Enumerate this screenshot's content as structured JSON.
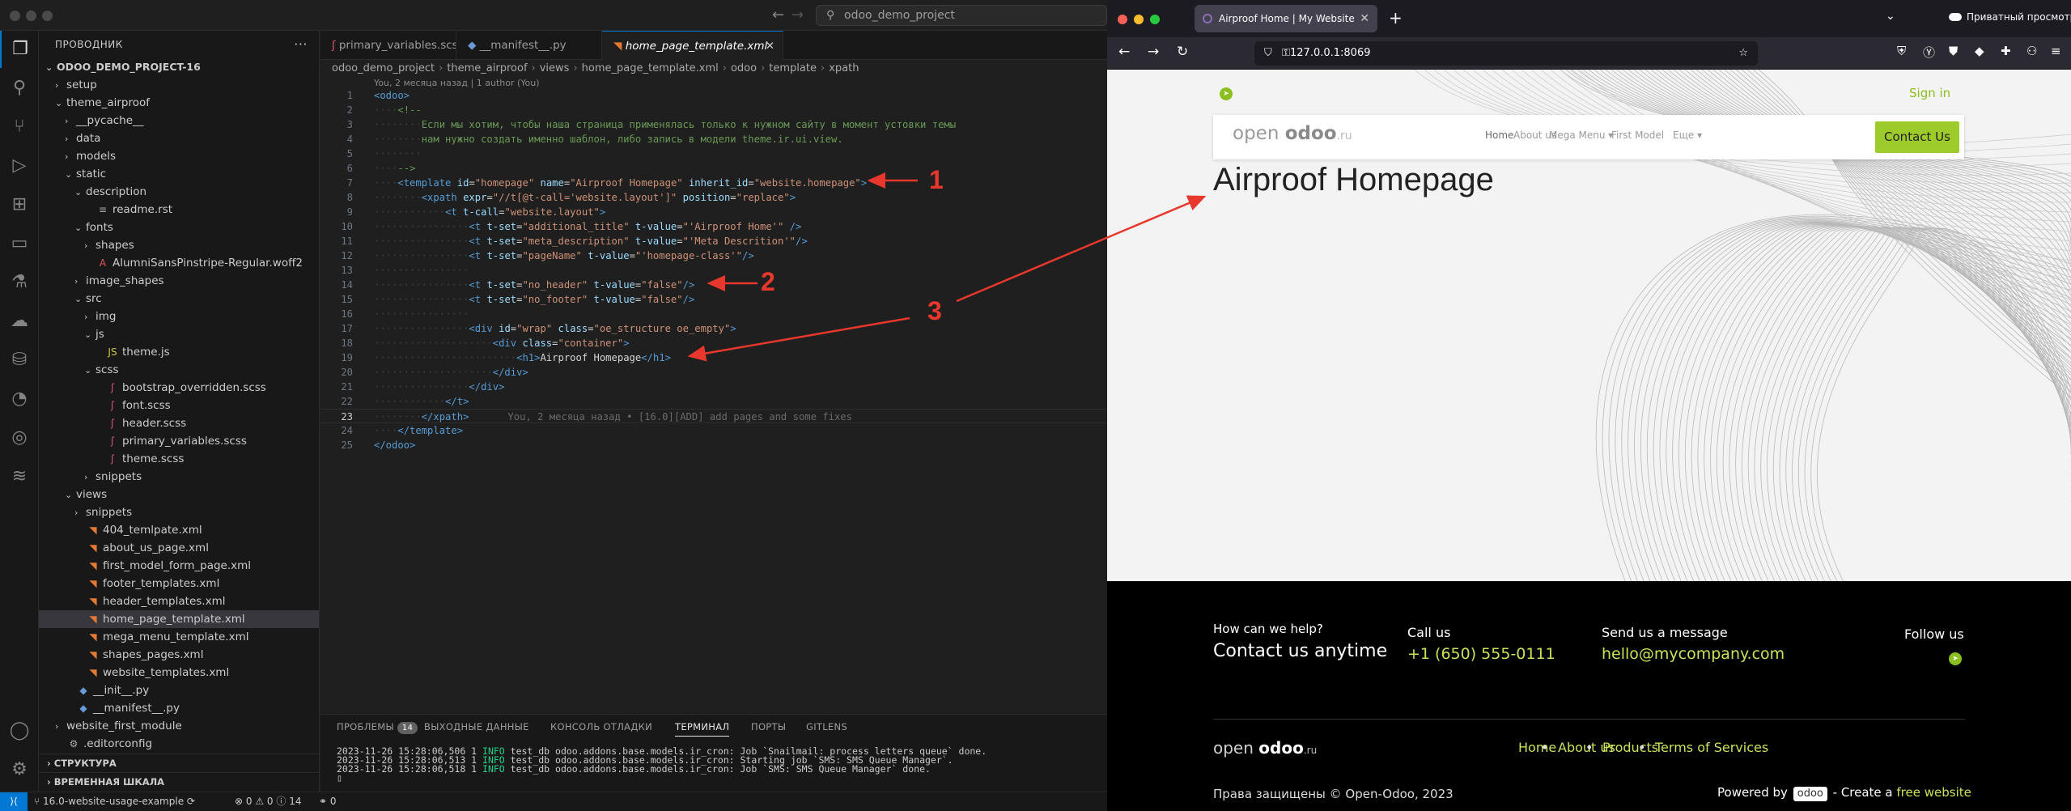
{
  "vscode": {
    "search_text": "odoo_demo_project",
    "sidebar_title": "ПРОВОДНИК",
    "tree": [
      {
        "label": "ODOO_DEMO_PROJECT-16",
        "depth": 0,
        "arrow": "down",
        "icon": "",
        "bold": true
      },
      {
        "label": "setup",
        "depth": 1,
        "arrow": "right",
        "icon": "",
        "bold": false
      },
      {
        "label": "theme_airproof",
        "depth": 1,
        "arrow": "down",
        "icon": "",
        "bold": false
      },
      {
        "label": "__pycache__",
        "depth": 2,
        "arrow": "right",
        "icon": "",
        "bold": false
      },
      {
        "label": "data",
        "depth": 2,
        "arrow": "right",
        "icon": "",
        "bold": false
      },
      {
        "label": "models",
        "depth": 2,
        "arrow": "right",
        "icon": "",
        "bold": false
      },
      {
        "label": "static",
        "depth": 2,
        "arrow": "down",
        "icon": "",
        "bold": false
      },
      {
        "label": "description",
        "depth": 3,
        "arrow": "down",
        "icon": "",
        "bold": false
      },
      {
        "label": "readme.rst",
        "depth": 4,
        "arrow": "",
        "icon": "rst",
        "bold": false
      },
      {
        "label": "fonts",
        "depth": 3,
        "arrow": "down",
        "icon": "",
        "bold": false
      },
      {
        "label": "shapes",
        "depth": 4,
        "arrow": "right",
        "icon": "",
        "bold": false
      },
      {
        "label": "AlumniSansPinstripe-Regular.woff2",
        "depth": 4,
        "arrow": "",
        "icon": "font",
        "bold": false
      },
      {
        "label": "image_shapes",
        "depth": 3,
        "arrow": "right",
        "icon": "",
        "bold": false
      },
      {
        "label": "src",
        "depth": 3,
        "arrow": "down",
        "icon": "",
        "bold": false
      },
      {
        "label": "img",
        "depth": 4,
        "arrow": "right",
        "icon": "",
        "bold": false
      },
      {
        "label": "js",
        "depth": 4,
        "arrow": "down",
        "icon": "",
        "bold": false
      },
      {
        "label": "theme.js",
        "depth": 5,
        "arrow": "",
        "icon": "js",
        "bold": false
      },
      {
        "label": "scss",
        "depth": 4,
        "arrow": "down",
        "icon": "",
        "bold": false
      },
      {
        "label": "bootstrap_overridden.scss",
        "depth": 5,
        "arrow": "",
        "icon": "scss",
        "bold": false
      },
      {
        "label": "font.scss",
        "depth": 5,
        "arrow": "",
        "icon": "scss",
        "bold": false
      },
      {
        "label": "header.scss",
        "depth": 5,
        "arrow": "",
        "icon": "scss",
        "bold": false
      },
      {
        "label": "primary_variables.scss",
        "depth": 5,
        "arrow": "",
        "icon": "scss",
        "bold": false
      },
      {
        "label": "theme.scss",
        "depth": 5,
        "arrow": "",
        "icon": "scss",
        "bold": false
      },
      {
        "label": "snippets",
        "depth": 4,
        "arrow": "right",
        "icon": "",
        "bold": false
      },
      {
        "label": "views",
        "depth": 2,
        "arrow": "down",
        "icon": "",
        "bold": false
      },
      {
        "label": "snippets",
        "depth": 3,
        "arrow": "right",
        "icon": "",
        "bold": false
      },
      {
        "label": "404_temlpate.xml",
        "depth": 3,
        "arrow": "",
        "icon": "xml",
        "bold": false
      },
      {
        "label": "about_us_page.xml",
        "depth": 3,
        "arrow": "",
        "icon": "xml",
        "bold": false
      },
      {
        "label": "first_model_form_page.xml",
        "depth": 3,
        "arrow": "",
        "icon": "xml",
        "bold": false
      },
      {
        "label": "footer_templates.xml",
        "depth": 3,
        "arrow": "",
        "icon": "xml",
        "bold": false
      },
      {
        "label": "header_templates.xml",
        "depth": 3,
        "arrow": "",
        "icon": "xml",
        "bold": false
      },
      {
        "label": "home_page_template.xml",
        "depth": 3,
        "arrow": "",
        "icon": "xml",
        "bold": false,
        "selected": true
      },
      {
        "label": "mega_menu_template.xml",
        "depth": 3,
        "arrow": "",
        "icon": "xml",
        "bold": false
      },
      {
        "label": "shapes_pages.xml",
        "depth": 3,
        "arrow": "",
        "icon": "xml",
        "bold": false
      },
      {
        "label": "website_templates.xml",
        "depth": 3,
        "arrow": "",
        "icon": "xml",
        "bold": false
      },
      {
        "label": "__init__.py",
        "depth": 2,
        "arrow": "",
        "icon": "py",
        "bold": false
      },
      {
        "label": "__manifest__.py",
        "depth": 2,
        "arrow": "",
        "icon": "py",
        "bold": false
      },
      {
        "label": "website_first_module",
        "depth": 1,
        "arrow": "right",
        "icon": "",
        "bold": false
      },
      {
        "label": ".editorconfig",
        "depth": 1,
        "arrow": "",
        "icon": "cfg",
        "bold": false
      }
    ],
    "outline_label": "СТРУКТУРА",
    "timeline_label": "ВРЕМЕННАЯ ШКАЛА",
    "tabs": [
      {
        "label": "primary_variables.scss",
        "icon": "scss",
        "active": false
      },
      {
        "label": "__manifest__.py",
        "icon": "py",
        "active": false
      },
      {
        "label": "home_page_template.xml",
        "icon": "xml",
        "active": true
      }
    ],
    "breadcrumb": [
      "odoo_demo_project",
      "theme_airproof",
      "views",
      "home_page_template.xml",
      "odoo",
      "template",
      "xpath"
    ],
    "blame_top": "You, 2 месяца назад | 1 author (You)",
    "ghost_blame": "You, 2 месяца назад • [16.0][ADD] add pages and some fixes",
    "current_line": 23,
    "panel_tabs": [
      "ПРОБЛЕМЫ",
      "ВЫХОДНЫЕ ДАННЫЕ",
      "КОНСОЛЬ ОТЛАДКИ",
      "ТЕРМИНАЛ",
      "ПОРТЫ",
      "GITLENS"
    ],
    "problems_count": "14",
    "active_panel_tab": "ТЕРМИНАЛ",
    "terminal": [
      {
        "prefix": "2023-11-26 15:28:06,506 1 ",
        "level": "INFO",
        "rest": " test_db odoo.addons.base.models.ir_cron: Job `Snailmail: process letters queue` done."
      },
      {
        "prefix": "2023-11-26 15:28:06,513 1 ",
        "level": "INFO",
        "rest": " test_db odoo.addons.base.models.ir_cron: Starting job `SMS: SMS Queue Manager`."
      },
      {
        "prefix": "2023-11-26 15:28:06,518 1 ",
        "level": "INFO",
        "rest": " test_db odoo.addons.base.models.ir_cron: Job `SMS: SMS Queue Manager` done."
      }
    ],
    "status": {
      "branch": "16.0-website-usage-example",
      "errors": "0",
      "warnings": "0",
      "info": "14",
      "ports": "0"
    }
  },
  "code_lines": [
    {
      "n": 1,
      "ind": 0,
      "t": [
        [
          "tg",
          "<odoo>"
        ]
      ]
    },
    {
      "n": 2,
      "ind": 1,
      "t": [
        [
          "cm",
          "<!--"
        ]
      ]
    },
    {
      "n": 3,
      "ind": 2,
      "t": [
        [
          "cm",
          "Если мы хотим, чтобы наша страница применялась только к нужном сайту в момент устовки темы"
        ]
      ]
    },
    {
      "n": 4,
      "ind": 2,
      "t": [
        [
          "cm",
          "нам нужно создать именно шаблон, либо запись в модели theme.ir.ui.view."
        ]
      ]
    },
    {
      "n": 5,
      "ind": 2,
      "t": []
    },
    {
      "n": 6,
      "ind": 1,
      "t": [
        [
          "cm",
          "-->"
        ]
      ]
    },
    {
      "n": 7,
      "ind": 1,
      "t": [
        [
          "tg",
          "<template"
        ],
        [
          "tx",
          " "
        ],
        [
          "at",
          "id"
        ],
        [
          "tx",
          "="
        ],
        [
          "sv",
          "\"homepage\""
        ],
        [
          "tx",
          " "
        ],
        [
          "at",
          "name"
        ],
        [
          "tx",
          "="
        ],
        [
          "sv",
          "\"Airproof Homepage\""
        ],
        [
          "tx",
          " "
        ],
        [
          "at",
          "inherit_id"
        ],
        [
          "tx",
          "="
        ],
        [
          "sv",
          "\"website.homepage\""
        ],
        [
          "tg",
          ">"
        ]
      ]
    },
    {
      "n": 8,
      "ind": 2,
      "t": [
        [
          "tg",
          "<xpath"
        ],
        [
          "tx",
          " "
        ],
        [
          "at",
          "expr"
        ],
        [
          "tx",
          "="
        ],
        [
          "sv",
          "\"//t[@t-call='website.layout']\""
        ],
        [
          "tx",
          " "
        ],
        [
          "at",
          "position"
        ],
        [
          "tx",
          "="
        ],
        [
          "sv",
          "\"replace\""
        ],
        [
          "tg",
          ">"
        ]
      ]
    },
    {
      "n": 9,
      "ind": 3,
      "t": [
        [
          "tg",
          "<t"
        ],
        [
          "tx",
          " "
        ],
        [
          "at",
          "t-call"
        ],
        [
          "tx",
          "="
        ],
        [
          "sv",
          "\"website.layout\""
        ],
        [
          "tg",
          ">"
        ]
      ]
    },
    {
      "n": 10,
      "ind": 4,
      "t": [
        [
          "tg",
          "<t"
        ],
        [
          "tx",
          " "
        ],
        [
          "at",
          "t-set"
        ],
        [
          "tx",
          "="
        ],
        [
          "sv",
          "\"additional_title\""
        ],
        [
          "tx",
          " "
        ],
        [
          "at",
          "t-value"
        ],
        [
          "tx",
          "="
        ],
        [
          "sv",
          "\"'Airproof Home'\""
        ],
        [
          "tx",
          " "
        ],
        [
          "tg",
          "/>"
        ]
      ]
    },
    {
      "n": 11,
      "ind": 4,
      "t": [
        [
          "tg",
          "<t"
        ],
        [
          "tx",
          " "
        ],
        [
          "at",
          "t-set"
        ],
        [
          "tx",
          "="
        ],
        [
          "sv",
          "\"meta_description\""
        ],
        [
          "tx",
          " "
        ],
        [
          "at",
          "t-value"
        ],
        [
          "tx",
          "="
        ],
        [
          "sv",
          "\"'Meta Descrition'\""
        ],
        [
          "tg",
          "/>"
        ]
      ]
    },
    {
      "n": 12,
      "ind": 4,
      "t": [
        [
          "tg",
          "<t"
        ],
        [
          "tx",
          " "
        ],
        [
          "at",
          "t-set"
        ],
        [
          "tx",
          "="
        ],
        [
          "sv",
          "\"pageName\""
        ],
        [
          "tx",
          " "
        ],
        [
          "at",
          "t-value"
        ],
        [
          "tx",
          "="
        ],
        [
          "sv",
          "\"'homepage-class'\""
        ],
        [
          "tg",
          "/>"
        ]
      ]
    },
    {
      "n": 13,
      "ind": 4,
      "t": []
    },
    {
      "n": 14,
      "ind": 4,
      "t": [
        [
          "tg",
          "<t"
        ],
        [
          "tx",
          " "
        ],
        [
          "at",
          "t-set"
        ],
        [
          "tx",
          "="
        ],
        [
          "sv",
          "\"no_header\""
        ],
        [
          "tx",
          " "
        ],
        [
          "at",
          "t-value"
        ],
        [
          "tx",
          "="
        ],
        [
          "sv",
          "\"false\""
        ],
        [
          "tg",
          "/>"
        ]
      ]
    },
    {
      "n": 15,
      "ind": 4,
      "t": [
        [
          "tg",
          "<t"
        ],
        [
          "tx",
          " "
        ],
        [
          "at",
          "t-set"
        ],
        [
          "tx",
          "="
        ],
        [
          "sv",
          "\"no_footer\""
        ],
        [
          "tx",
          " "
        ],
        [
          "at",
          "t-value"
        ],
        [
          "tx",
          "="
        ],
        [
          "sv",
          "\"false\""
        ],
        [
          "tg",
          "/>"
        ]
      ]
    },
    {
      "n": 16,
      "ind": 4,
      "t": []
    },
    {
      "n": 17,
      "ind": 4,
      "t": [
        [
          "tg",
          "<div"
        ],
        [
          "tx",
          " "
        ],
        [
          "at",
          "id"
        ],
        [
          "tx",
          "="
        ],
        [
          "sv",
          "\"wrap\""
        ],
        [
          "tx",
          " "
        ],
        [
          "at",
          "class"
        ],
        [
          "tx",
          "="
        ],
        [
          "sv",
          "\"oe_structure oe_empty\""
        ],
        [
          "tg",
          ">"
        ]
      ]
    },
    {
      "n": 18,
      "ind": 5,
      "t": [
        [
          "tg",
          "<div"
        ],
        [
          "tx",
          " "
        ],
        [
          "at",
          "class"
        ],
        [
          "tx",
          "="
        ],
        [
          "sv",
          "\"container\""
        ],
        [
          "tg",
          ">"
        ]
      ]
    },
    {
      "n": 19,
      "ind": 6,
      "t": [
        [
          "tg",
          "<h1>"
        ],
        [
          "tx",
          "Airproof Homepage"
        ],
        [
          "tg",
          "</h1>"
        ]
      ]
    },
    {
      "n": 20,
      "ind": 5,
      "t": [
        [
          "tg",
          "</div>"
        ]
      ]
    },
    {
      "n": 21,
      "ind": 4,
      "t": [
        [
          "tg",
          "</div>"
        ]
      ]
    },
    {
      "n": 22,
      "ind": 3,
      "t": [
        [
          "tg",
          "</t>"
        ]
      ]
    },
    {
      "n": 23,
      "ind": 2,
      "t": [
        [
          "tg",
          "</xpath>"
        ]
      ]
    },
    {
      "n": 24,
      "ind": 1,
      "t": [
        [
          "tg",
          "</template>"
        ]
      ]
    },
    {
      "n": 25,
      "ind": 0,
      "t": [
        [
          "tg",
          "</odoo>"
        ]
      ]
    }
  ],
  "annotations": {
    "labels": [
      "1",
      "2",
      "3"
    ],
    "color": "#e8372c"
  },
  "browser": {
    "tab_title": "Airproof Home | My Website",
    "private_label": "Приватный просмотр",
    "url": "127.0.0.1:8069",
    "site": {
      "signin": "Sign in",
      "logo": {
        "open": "open",
        "odoo": "odoo",
        "ru": ".ru"
      },
      "nav": [
        {
          "label": "Home",
          "active": true,
          "dropdown": false
        },
        {
          "label": "About us",
          "active": false,
          "dropdown": false
        },
        {
          "label": "Mega Menu",
          "active": false,
          "dropdown": true
        },
        {
          "label": "First Model",
          "active": false,
          "dropdown": false
        },
        {
          "label": "Еще",
          "active": false,
          "dropdown": true
        }
      ],
      "contact_button": "Contact Us",
      "heading": "Airproof Homepage",
      "accent": "#9dcb2b",
      "footer": {
        "help_small": "How can we help?",
        "help_big": "Contact us anytime",
        "call_label": "Call us",
        "phone": "+1 (650) 555-0111",
        "msg_label": "Send us a message",
        "email": "hello@mycompany.com",
        "follow_label": "Follow us",
        "links": [
          "Home",
          "About us",
          "Products",
          "Terms of Services"
        ],
        "copyright": "Права защищены © Open-Odoo, 2023",
        "powered_by": "Powered by",
        "powered_badge": "odoo",
        "create_a": "- Create a",
        "free_website": "free website"
      }
    }
  }
}
